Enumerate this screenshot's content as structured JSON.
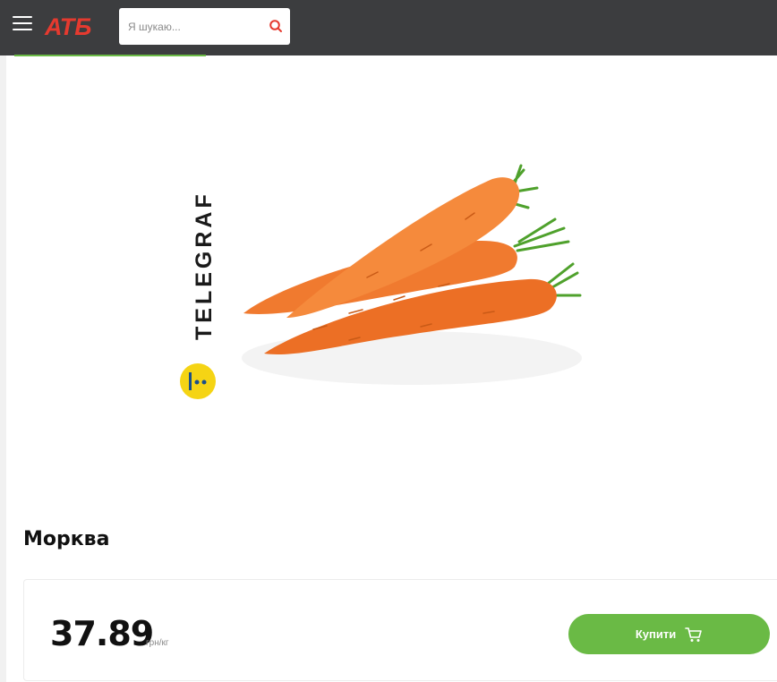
{
  "header": {
    "logo_text": "АТБ",
    "menu_icon": "hamburger-menu-icon",
    "search": {
      "placeholder": "Я шукаю...",
      "icon": "search-icon"
    },
    "colors": {
      "background": "#3c3d3f",
      "logo": "#e53a2f",
      "search_icon": "#e53a2f"
    }
  },
  "product": {
    "image_watermark": "TELEGRAF",
    "name": "Морква",
    "price": "37.89",
    "unit": "грн/кг",
    "buy_label": "Купити",
    "cart_icon": "shopping-cart-icon"
  },
  "colors": {
    "accent": "#6aba45"
  }
}
